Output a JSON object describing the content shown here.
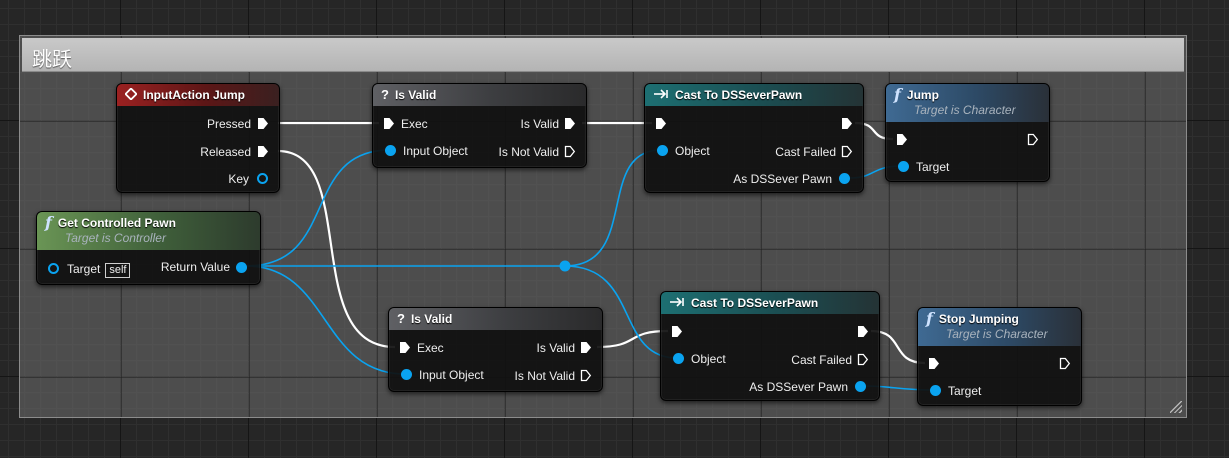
{
  "comment": {
    "title": "跳跃"
  },
  "nodes": {
    "input_action": {
      "title": "InputAction Jump",
      "pins": {
        "pressed": "Pressed",
        "released": "Released",
        "key": "Key"
      }
    },
    "get_controlled_pawn": {
      "title": "Get Controlled Pawn",
      "subtitle": "Target is Controller",
      "pins": {
        "target": "Target",
        "self": "self",
        "return_value": "Return Value"
      }
    },
    "is_valid_1": {
      "title": "Is Valid",
      "pins": {
        "exec": "Exec",
        "input_object": "Input Object",
        "is_valid": "Is Valid",
        "is_not_valid": "Is Not Valid"
      }
    },
    "is_valid_2": {
      "title": "Is Valid",
      "pins": {
        "exec": "Exec",
        "input_object": "Input Object",
        "is_valid": "Is Valid",
        "is_not_valid": "Is Not Valid"
      }
    },
    "cast_1": {
      "title": "Cast To DSSeverPawn",
      "pins": {
        "object": "Object",
        "cast_failed": "Cast Failed",
        "as_pawn": "As DSSever Pawn"
      }
    },
    "cast_2": {
      "title": "Cast To DSSeverPawn",
      "pins": {
        "object": "Object",
        "cast_failed": "Cast Failed",
        "as_pawn": "As DSSever Pawn"
      }
    },
    "jump": {
      "title": "Jump",
      "subtitle": "Target is Character",
      "pins": {
        "target": "Target"
      }
    },
    "stop_jumping": {
      "title": "Stop Jumping",
      "subtitle": "Target is Character",
      "pins": {
        "target": "Target"
      }
    }
  },
  "colors": {
    "exec_wire": "#ffffff",
    "object_wire": "#0aa3f0",
    "event_header": "#9b2121",
    "pure_header": "#5f6064",
    "cast_header": "#1d6f72",
    "function_header": "#3f6a93",
    "getter_header": "#6a9555"
  },
  "icons": {
    "event": "event-diamond-icon",
    "is_valid": "question-mark-icon",
    "cast": "cast-arrow-icon",
    "function": "function-f-icon"
  }
}
